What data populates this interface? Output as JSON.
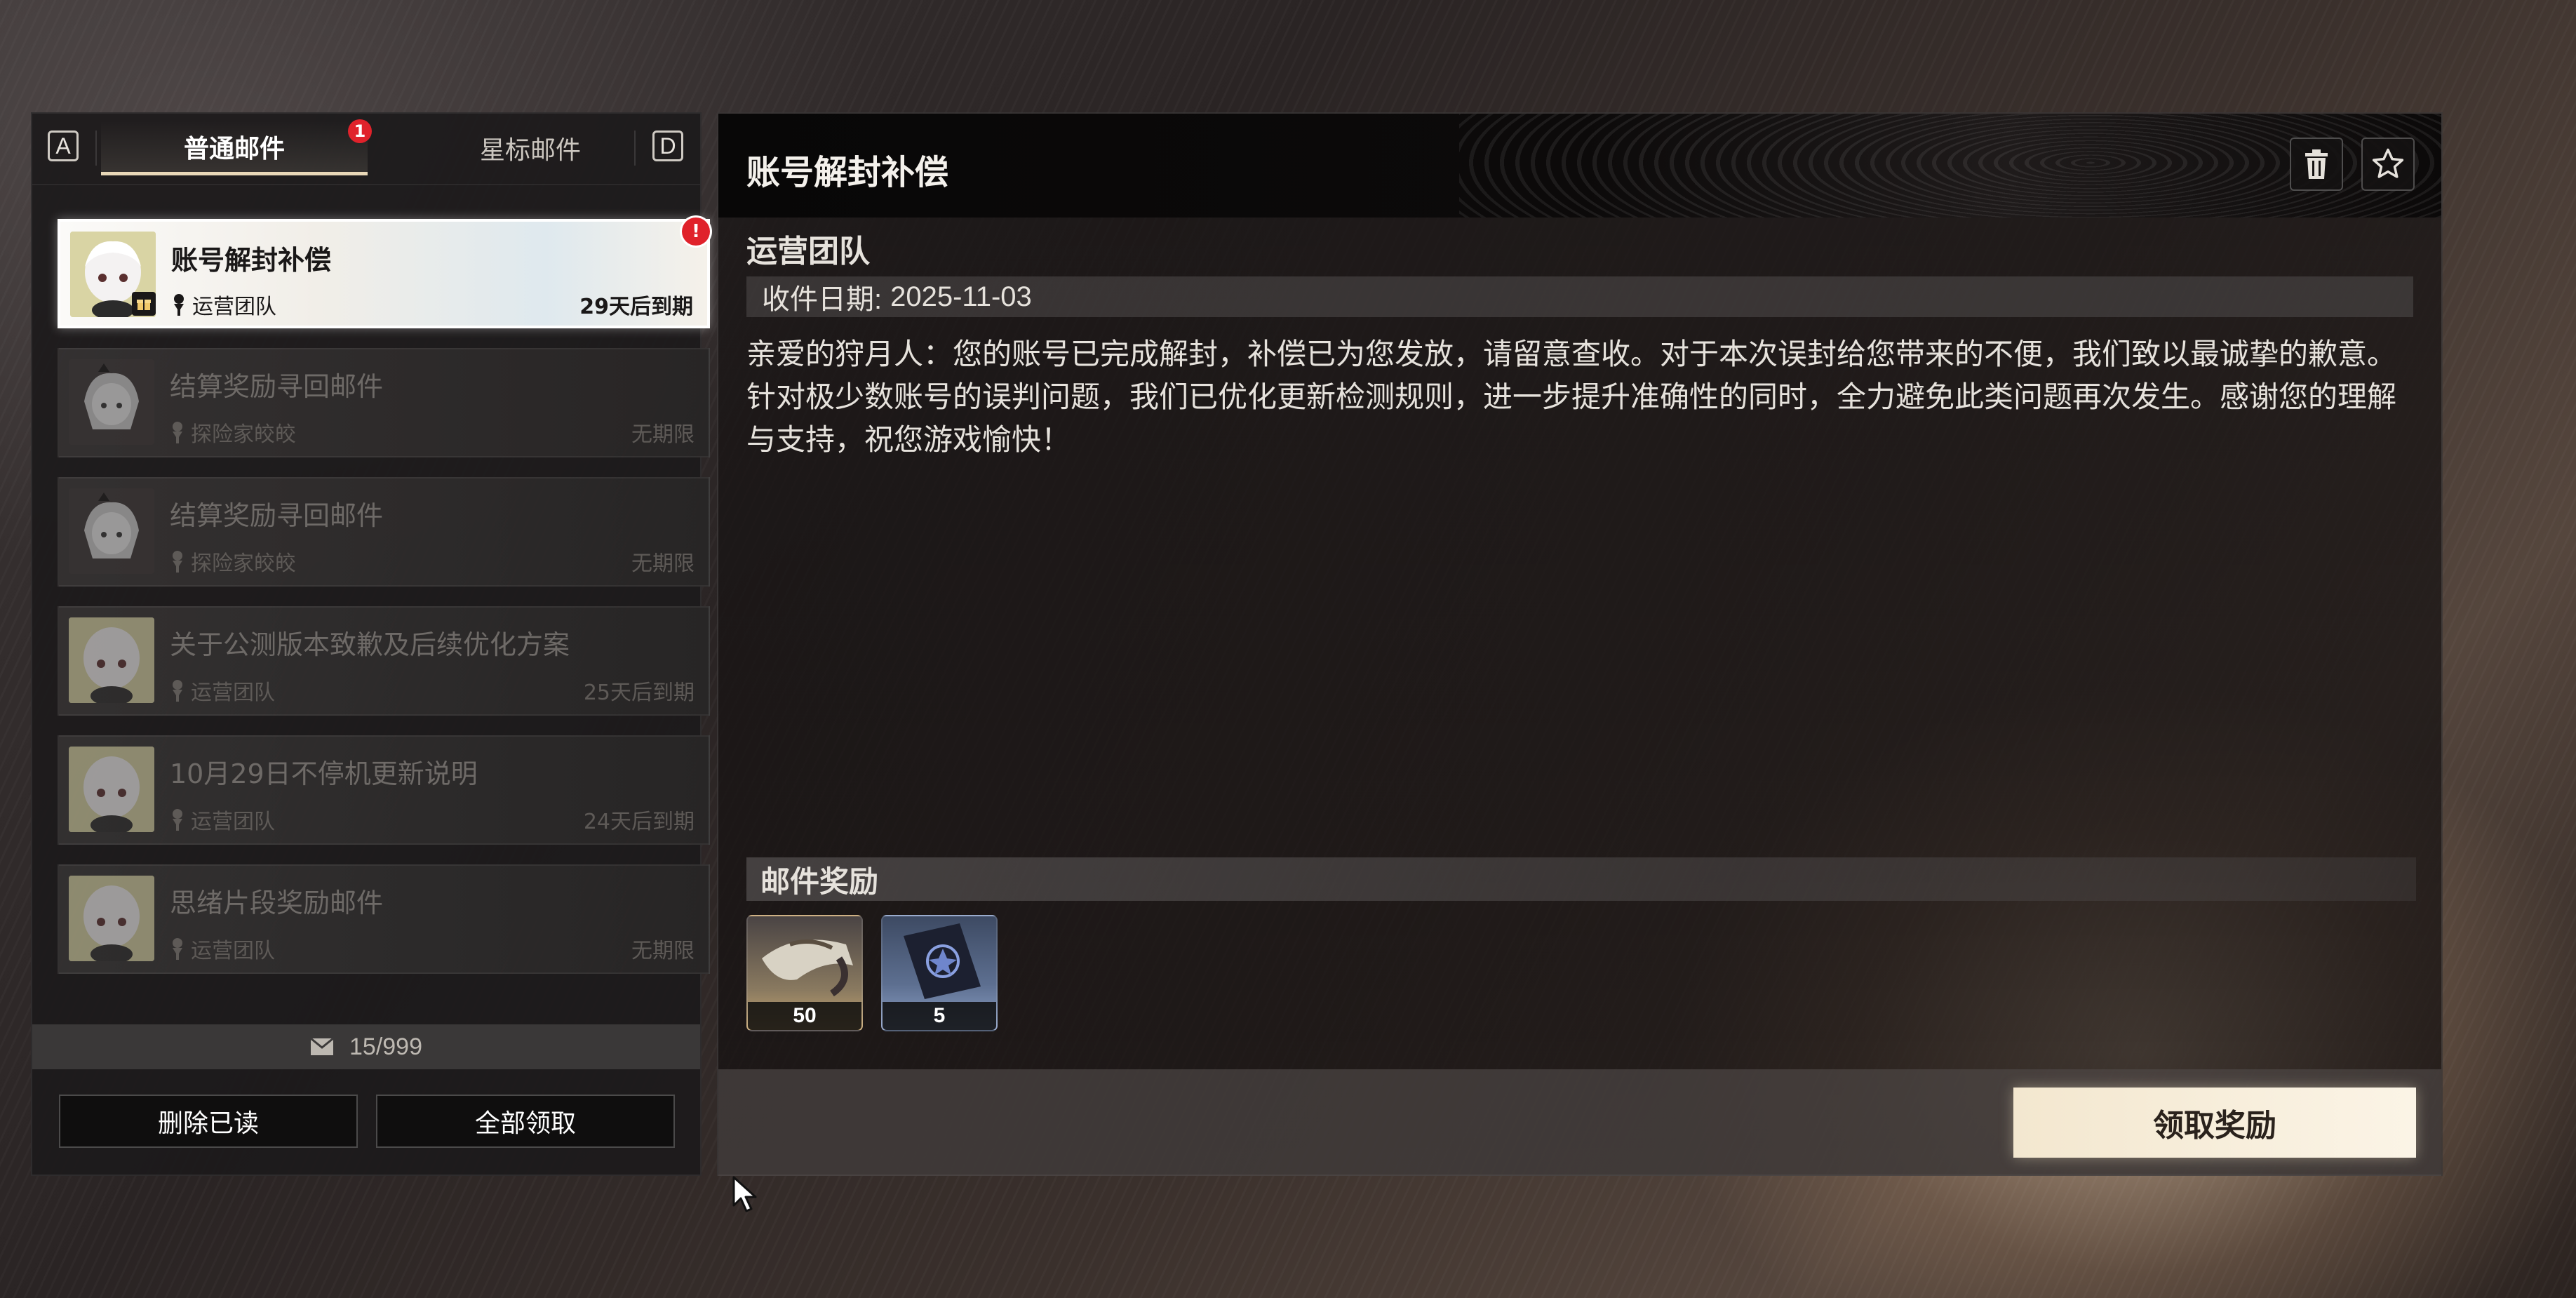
{
  "left_panel": {
    "key_left": "A",
    "key_right": "D",
    "tabs": [
      {
        "label": "普通邮件",
        "badge": "1"
      },
      {
        "label": "星标邮件"
      }
    ],
    "mails": [
      {
        "title": "账号解封补偿",
        "sender": "运营团队",
        "expiry": "29天后到期",
        "avatar": "team-avatar",
        "unread_badge": "!"
      },
      {
        "title": "结算奖励寻回邮件",
        "sender": "探险家皎皎",
        "expiry": "无期限",
        "avatar": "hunter-avatar"
      },
      {
        "title": "结算奖励寻回邮件",
        "sender": "探险家皎皎",
        "expiry": "无期限",
        "avatar": "hunter-avatar"
      },
      {
        "title": "关于公测版本致歉及后续优化方案",
        "sender": "运营团队",
        "expiry": "25天后到期",
        "avatar": "team-avatar"
      },
      {
        "title": "10月29日不停机更新说明",
        "sender": "运营团队",
        "expiry": "24天后到期",
        "avatar": "team-avatar"
      },
      {
        "title": "思绪片段奖励邮件",
        "sender": "运营团队",
        "expiry": "无期限",
        "avatar": "team-avatar"
      }
    ],
    "mail_count": "15/999",
    "delete_read_label": "删除已读",
    "claim_all_label": "全部领取"
  },
  "detail": {
    "title": "账号解封补偿",
    "sender": "运营团队",
    "date_label": "收件日期:",
    "date_value": "2025-11-03",
    "body_line1": "亲爱的狩月人：您的账号已完成解封，补偿已为您发放，请留意查收。对于本次误封给您带来的不便，我们致以最诚挚的歉意。",
    "body_line2": "针对极少数账号的误判问题，我们已优化更新检测规则，进一步提升准确性的同时，全力避免此类问题再次发生。感谢您的理解与支持，祝您游戏愉快！",
    "reward_header": "邮件奖励",
    "rewards": [
      {
        "icon": "bird-feather-item-icon",
        "qty": "50"
      },
      {
        "icon": "dark-card-pack-item-icon",
        "qty": "5"
      }
    ],
    "claim_label": "领取奖励"
  }
}
